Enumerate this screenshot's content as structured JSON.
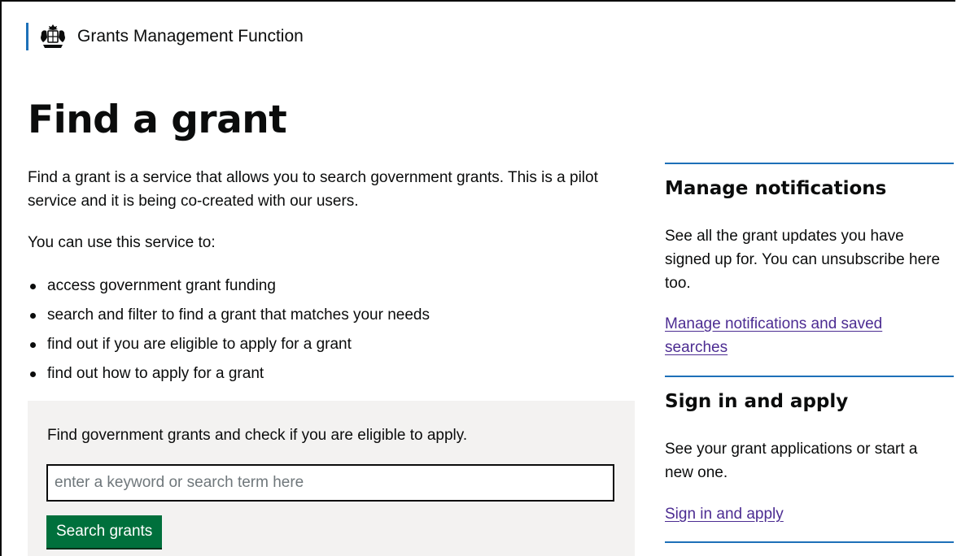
{
  "header": {
    "org_name": "Grants Management Function",
    "crest_icon": "royal-coat-of-arms-icon",
    "accent_color": "#1d70b8"
  },
  "page": {
    "title": "Find a grant",
    "intro": "Find a grant is a service that allows you to search government grants. This is a pilot service and it is being co-created with our users.",
    "use_lead": "You can use this service to:",
    "bullets": [
      "access government grant funding",
      "search and filter to find a grant that matches your needs",
      "find out if you are eligible to apply for a grant",
      "find out how to apply for a grant"
    ]
  },
  "search": {
    "lead": "Find government grants and check if you are eligible to apply.",
    "placeholder": "enter a keyword or search term here",
    "value": "",
    "button_label": "Search grants",
    "button_color": "#00703c"
  },
  "aside": {
    "notifications": {
      "heading": "Manage notifications",
      "text": "See all the grant updates you have signed up for. You can unsubscribe here too.",
      "link": "Manage notifications and saved searches"
    },
    "signin": {
      "heading": "Sign in and apply",
      "text": "See your grant applications or start a new one.",
      "link": "Sign in and apply"
    },
    "link_color": "#4c2c92"
  }
}
